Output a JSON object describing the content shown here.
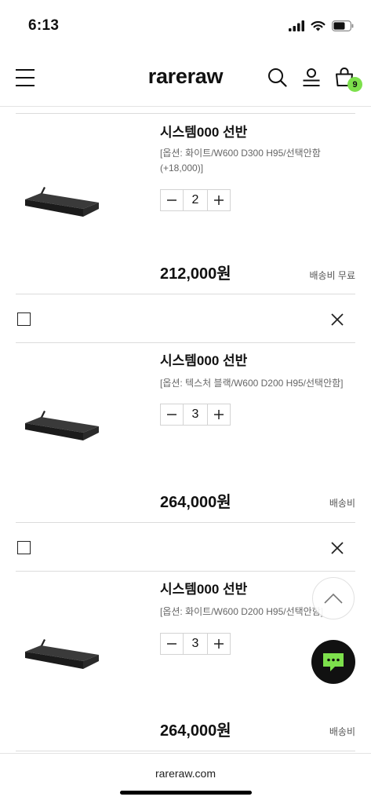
{
  "status": {
    "time": "6:13",
    "battery_level": 0.7
  },
  "header": {
    "logo": "rareraw",
    "menu_icon": "hamburger-icon",
    "search_icon": "search-icon",
    "account_icon": "user-icon",
    "cart_icon": "shopping-bag-icon",
    "cart_count": "9",
    "badge_color": "#7de04c"
  },
  "cart_items": [
    {
      "name": "시스템000 선반",
      "option_line1": "[옵션: 화이트/W600 D300 H95/선택안함",
      "option_line2": "(+18,000)]",
      "qty": "2",
      "price": "212,000원",
      "shipping": "배송비 무료"
    },
    {
      "name": "시스템000 선반",
      "option_line1": "[옵션: 텍스처 블랙/W600 D200 H95/선택안함]",
      "qty": "3",
      "price": "264,000원",
      "shipping": "배송비"
    },
    {
      "name": "시스템000 선반",
      "option_line1": "[옵션: 화이트/W600 D200 H95/선택안함]",
      "qty": "3",
      "price": "264,000원",
      "shipping": "배송비"
    }
  ],
  "qty_controls": {
    "minus_icon": "minus-icon",
    "plus_icon": "plus-icon"
  },
  "floating": {
    "scroll_top_icon": "chevron-up-icon",
    "chat_icon": "chat-bubble-icon",
    "chat_color": "#7de04c"
  },
  "footer": {
    "url": "rareraw.com"
  }
}
